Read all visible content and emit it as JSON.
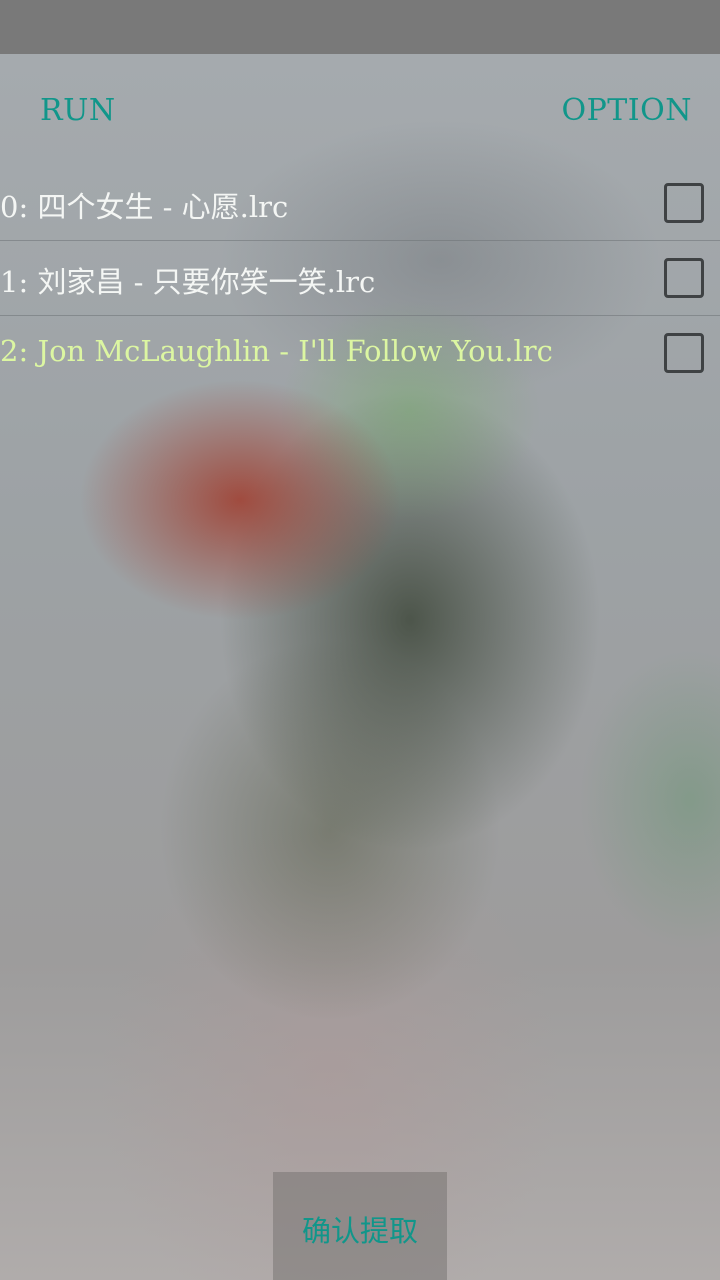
{
  "toolbar": {
    "run_label": "RUN",
    "option_label": "OPTION"
  },
  "files": [
    {
      "label": "0: 四个女生 - 心愿.lrc",
      "checked": false
    },
    {
      "label": "1: 刘家昌 - 只要你笑一笑.lrc",
      "checked": false
    },
    {
      "label": "2: Jon McLaughlin - I'll Follow You.lrc",
      "checked": false
    }
  ],
  "confirm": {
    "label": "确认提取"
  },
  "colors": {
    "accent": "#11968a",
    "highlight_text": "#dcf6a2",
    "status_bar": "#797979"
  }
}
